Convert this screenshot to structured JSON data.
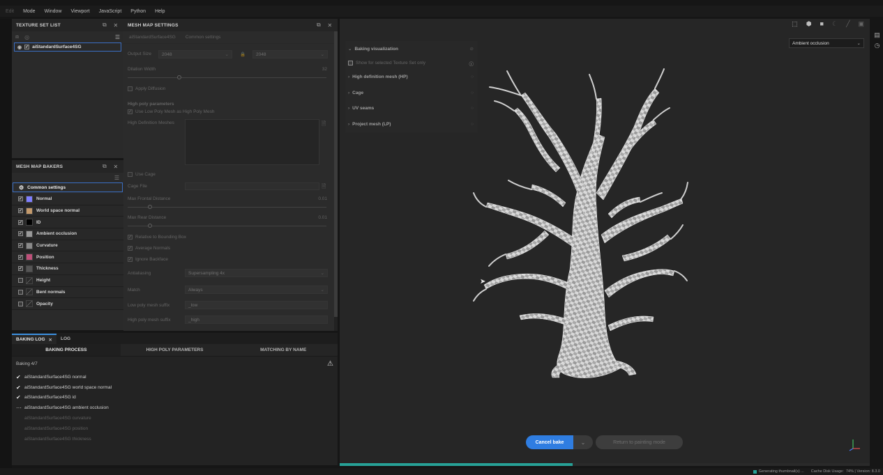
{
  "menu": [
    "Edit",
    "Mode",
    "Window",
    "Viewport",
    "JavaScript",
    "Python",
    "Help"
  ],
  "texture_set_list": {
    "title": "TEXTURE SET LIST",
    "item": "aiStandardSurface4SG"
  },
  "mesh_map_bakers": {
    "title": "MESH MAP BAKERS",
    "common": "Common settings",
    "bakers": [
      {
        "label": "Normal",
        "color": "#7f7fff"
      },
      {
        "label": "World space normal",
        "color": "#c49a6c"
      },
      {
        "label": "ID",
        "color": "#000000"
      },
      {
        "label": "Ambient occlusion",
        "color": "#9a9a9a"
      },
      {
        "label": "Curvature",
        "color": "#8a8a8a"
      },
      {
        "label": "Position",
        "color": "#c0507a"
      },
      {
        "label": "Thickness",
        "color": "#555555"
      },
      {
        "label": "Height",
        "color": "#303030"
      },
      {
        "label": "Bent normals",
        "color": "#303030"
      },
      {
        "label": "Opacity",
        "color": "#303030"
      }
    ]
  },
  "mesh_map_settings": {
    "title": "MESH MAP SETTINGS",
    "crumb_item": "aiStandardSurface4SG",
    "crumb_common": "Common settings",
    "output_size_label": "Output Size",
    "output_size_a": "2048",
    "output_size_b": "2048",
    "dilation_label": "Dilation Width",
    "dilation_value": "32",
    "apply_diffusion": "Apply Diffusion",
    "high_poly_title": "High poly parameters",
    "use_low_poly": "Use Low Poly Mesh as High Poly Mesh",
    "hd_meshes": "High Definition Meshes",
    "use_cage": "Use Cage",
    "cage_file": "Cage File",
    "max_frontal": "Max Frontal Distance",
    "max_frontal_val": "0.01",
    "max_rear": "Max Rear Distance",
    "max_rear_val": "0.01",
    "relative_bbox": "Relative to Bounding Box",
    "average_normals": "Average Normals",
    "ignore_backface": "Ignore Backface",
    "antialiasing_label": "Antialiasing",
    "antialiasing_value": "Supersampling 4x",
    "match_label": "Match",
    "match_value": "Always",
    "low_suffix_label": "Low poly mesh suffix",
    "low_suffix_value": "_low",
    "high_suffix_label": "High poly mesh suffix",
    "high_suffix_value": "_high"
  },
  "baking_log": {
    "tab_active": "BAKING LOG",
    "tab_other": "LOG",
    "subtabs": [
      "BAKING PROCESS",
      "HIGH POLY PARAMETERS",
      "MATCHING BY NAME"
    ],
    "status": "Baking 4/7",
    "lines": [
      {
        "text": "aiStandardSurface4SG normal",
        "state": "done"
      },
      {
        "text": "aiStandardSurface4SG world space normal",
        "state": "done"
      },
      {
        "text": "aiStandardSurface4SG id",
        "state": "done"
      },
      {
        "text": "aiStandardSurface4SG ambient occlusion",
        "state": "running"
      },
      {
        "text": "aiStandardSurface4SG curvature",
        "state": "pending"
      },
      {
        "text": "aiStandardSurface4SG position",
        "state": "pending"
      },
      {
        "text": "aiStandardSurface4SG thickness",
        "state": "pending"
      }
    ]
  },
  "viewport": {
    "display_mode": "Ambient occlusion",
    "baking_visualization": "Baking visualization",
    "show_selected": "Show for selected Texture Set only",
    "sections": [
      "High definition mesh (HP)",
      "Cage",
      "UV seams",
      "Project mesh (LP)"
    ],
    "cancel_bake": "Cancel bake",
    "return_painting": "Return to painting mode",
    "bake_progress": 0.44
  },
  "statusbar": {
    "generating": "Generating thumbnail(s) ...",
    "cache": "Cache Disk Usage:",
    "usage": "74% | Version: 8.3.0"
  }
}
